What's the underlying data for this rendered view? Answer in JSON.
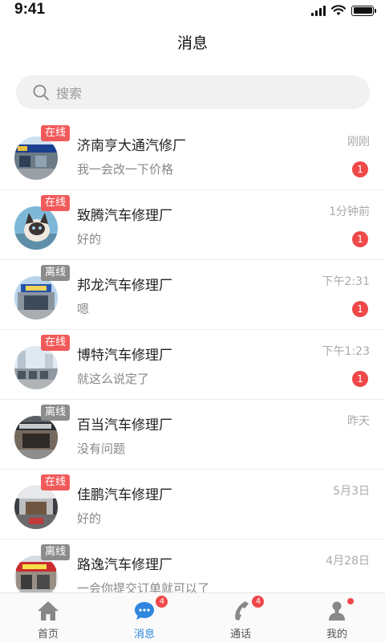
{
  "status_bar": {
    "time": "9:41"
  },
  "header": {
    "title": "消息"
  },
  "search": {
    "placeholder": "搜索"
  },
  "tag_labels": {
    "online": "在线",
    "offline": "离线"
  },
  "conversations": [
    {
      "name": "济南亨大通汽修厂",
      "preview": "我一会改一下价格",
      "time": "刚刚",
      "status": "online",
      "unread": "1"
    },
    {
      "name": "致腾汽车修理厂",
      "preview": "好的",
      "time": "1分钟前",
      "status": "online",
      "unread": "1"
    },
    {
      "name": "邦龙汽车修理厂",
      "preview": "嗯",
      "time": "下午2:31",
      "status": "offline",
      "unread": "1"
    },
    {
      "name": "博特汽车修理厂",
      "preview": "就这么说定了",
      "time": "下午1:23",
      "status": "online",
      "unread": "1"
    },
    {
      "name": "百当汽车修理厂",
      "preview": "没有问题",
      "time": "昨天",
      "status": "offline",
      "unread": ""
    },
    {
      "name": "佳鹏汽车修理厂",
      "preview": "好的",
      "time": "5月3日",
      "status": "online",
      "unread": ""
    },
    {
      "name": "路逸汽车修理厂",
      "preview": "一会你提交订单就可以了",
      "time": "4月28日",
      "status": "offline",
      "unread": ""
    }
  ],
  "tabbar": {
    "home": {
      "label": "首页",
      "icon": "home-icon"
    },
    "messages": {
      "label": "消息",
      "icon": "chat-icon",
      "badge": "4"
    },
    "calls": {
      "label": "通话",
      "icon": "phone-icon",
      "badge": "4"
    },
    "mine": {
      "label": "我的",
      "icon": "user-icon"
    }
  },
  "colors": {
    "accent": "#2e86de",
    "badge": "#f04848",
    "online": "#f15a5a",
    "offline": "#8c8c8c"
  }
}
